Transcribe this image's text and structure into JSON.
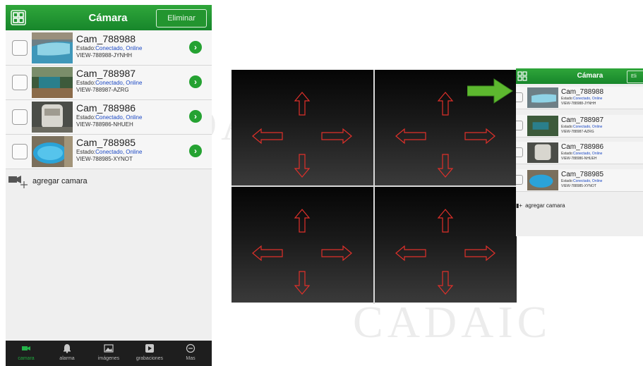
{
  "watermark": "CADAIC",
  "app": {
    "title": "Cámara",
    "delete_label": "Eliminar",
    "add_camera_label": "agregar camara",
    "state_prefix": "Estado:"
  },
  "cameras": [
    {
      "name": "Cam_788988",
      "state": "Conectado, Online",
      "id": "VIEW-788988-JYNHH",
      "thumb": "pool"
    },
    {
      "name": "Cam_788987",
      "state": "Conectado, Online",
      "id": "VIEW-788987-AZRG",
      "thumb": "yard"
    },
    {
      "name": "Cam_788986",
      "state": "Conectado, Online",
      "id": "VIEW-788986-NHUEH",
      "thumb": "boat"
    },
    {
      "name": "Cam_788985",
      "state": "Conectado, Online",
      "id": "VIEW-788985-XYNOT",
      "thumb": "pool-top"
    }
  ],
  "tabs": [
    {
      "label": "camara",
      "icon": "video-camera-icon",
      "active": true
    },
    {
      "label": "alarma",
      "icon": "bell-icon",
      "active": false
    },
    {
      "label": "imágenes",
      "icon": "image-icon",
      "active": false
    },
    {
      "label": "grabaciones",
      "icon": "play-icon",
      "active": false
    },
    {
      "label": "Mas",
      "icon": "minus-circle-icon",
      "active": false
    }
  ],
  "mini": {
    "title": "Cámara",
    "delete_label": "Eli",
    "add_camera_label": "agregar camara"
  },
  "colors": {
    "header_green": "#1f9a30",
    "arrow_red": "#e0302a",
    "status_blue": "#1b48c4",
    "pointer_green": "#5db82f"
  },
  "quad_view": {
    "panels": 4,
    "arrows_per_panel": [
      "up",
      "left",
      "right",
      "down"
    ]
  }
}
